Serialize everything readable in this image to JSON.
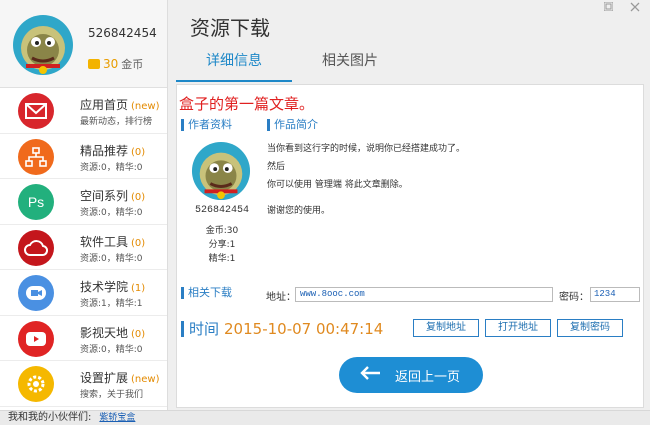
{
  "profile": {
    "uid": "526842454",
    "coins": "30",
    "coins_unit": "金币"
  },
  "window": {
    "title": "资源下载",
    "min_icon": "minimize-icon",
    "close_icon": "close-icon"
  },
  "tabs": [
    {
      "label": "详细信息",
      "active": true
    },
    {
      "label": "相关图片",
      "active": false
    }
  ],
  "sidebar": {
    "items": [
      {
        "icon": "mail-icon",
        "color": "#d8262c",
        "glyph": "",
        "title": "应用首页",
        "badge": "(new)",
        "sub": "最新动态，排行榜"
      },
      {
        "icon": "sitemap-icon",
        "color": "#f06a1c",
        "glyph": "",
        "title": "精品推荐",
        "badge": "(0)",
        "sub": "资源:0，精华:0"
      },
      {
        "icon": "photoshop-icon",
        "color": "#22b07d",
        "glyph": "Ps",
        "title": "空间系列",
        "badge": "(0)",
        "sub": "资源:0，精华:0"
      },
      {
        "icon": "creative-cloud-icon",
        "color": "#c4161c",
        "glyph": "",
        "title": "软件工具",
        "badge": "(0)",
        "sub": "资源:0，精华:0"
      },
      {
        "icon": "video-call-icon",
        "color": "#4a90e2",
        "glyph": "",
        "title": "技术学院",
        "badge": "(1)",
        "sub": "资源:1，精华:1"
      },
      {
        "icon": "youtube-icon",
        "color": "#e02424",
        "glyph": "",
        "title": "影视天地",
        "badge": "(0)",
        "sub": "资源:0，精华:0"
      },
      {
        "icon": "settings-gear-icon",
        "color": "#f5b800",
        "glyph": "",
        "title": "设置扩展",
        "badge": "(new)",
        "sub": "搜索，关于我们"
      }
    ]
  },
  "article": {
    "title": "盒子的第一篇文章。",
    "author_section": "作者资料",
    "intro_section": "作品简介",
    "author_id": "526842454",
    "stats": [
      "金币:30",
      "分享:1",
      "精华:1"
    ],
    "intro_lines": [
      "当你看到这行字的时候，说明你已经搭建成功了。",
      "然后",
      "你可以使用 管理端 将此文章删除。",
      "",
      "谢谢您的使用。"
    ],
    "download_section": "相关下载",
    "address_label": "地址：",
    "address_value": "www.8ooc.com",
    "password_label": "密码：",
    "password_value": "1234",
    "time_label": "时间",
    "time_value": "2015-10-07 00:47:14",
    "buttons": {
      "copy_address": "复制地址",
      "open_address": "打开地址",
      "copy_password": "复制密码"
    },
    "back_button": "返回上一页"
  },
  "footer": {
    "text": "我和我的小伙伴们:",
    "link": "紫轿宝盒"
  }
}
